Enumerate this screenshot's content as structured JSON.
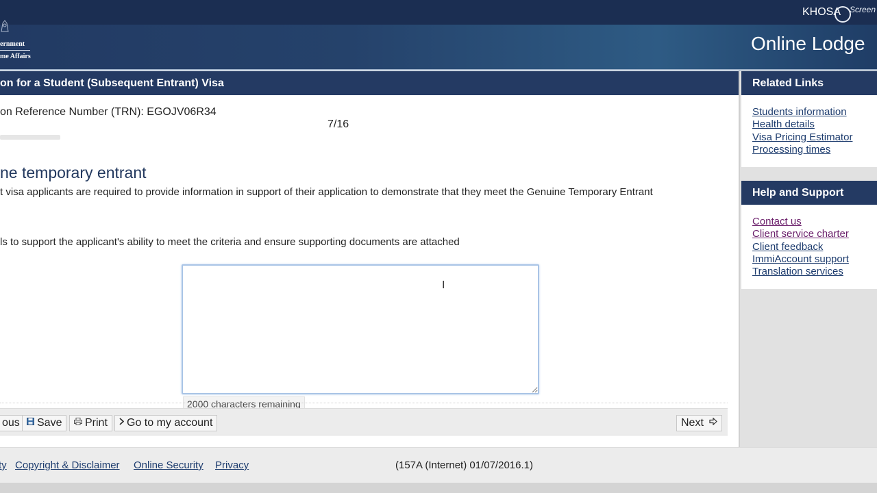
{
  "header": {
    "logo_line1": "ernment",
    "logo_line2": "me Affairs",
    "user_name": "KHOSA",
    "watermark_text": "Screen",
    "app_title": "Online Lodge"
  },
  "form": {
    "title": "on for a Student (Subsequent Entrant) Visa",
    "trn_label": "on Reference Number (TRN): EGOJV06R34",
    "page_count": "7/16",
    "progress": 0.4375,
    "section_heading": "ne temporary entrant",
    "intro_text": "t visa applicants are required to provide information in support of their application to demonstrate that they meet the Genuine Temporary Entrant",
    "question_text": "ls to support the applicant's ability to meet the criteria and ensure supporting documents are attached",
    "textarea_value": "",
    "chars_remaining": "2000 characters remaining"
  },
  "buttons": {
    "previous": "ous",
    "save": "Save",
    "print": "Print",
    "account": "Go to my account",
    "next": "Next"
  },
  "icons": {
    "save": "floppy-disk-icon",
    "print": "printer-icon",
    "account": "chevron-right-icon",
    "next": "arrow-right-icon"
  },
  "sidebar": {
    "related_title": "Related Links",
    "related_links": [
      "Students information",
      "Health details",
      "Visa Pricing Estimator",
      "Processing times"
    ],
    "help_title": "Help and Support",
    "help_links": [
      "Contact us",
      "Client service charter",
      "Client feedback",
      "ImmiAccount support",
      "Translation services"
    ]
  },
  "footer": {
    "accessibility": "ty",
    "copyright": "Copyright & Disclaimer",
    "security": "Online Security",
    "privacy": "Privacy",
    "version": "(157A (Internet) 01/07/2016.1)"
  },
  "colors": {
    "navy": "#243a63",
    "link": "#1d3c6e",
    "visited_link": "#6b1f6b",
    "focus_border": "#a9c4e6"
  }
}
